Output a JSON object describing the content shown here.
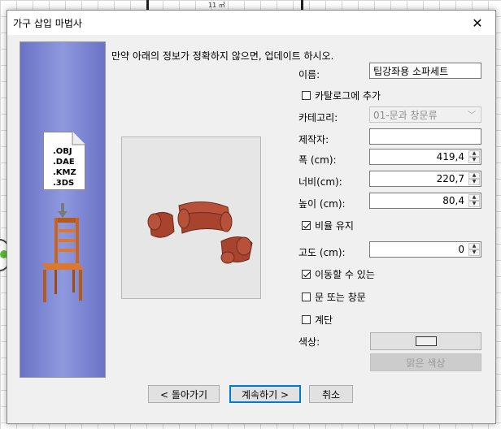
{
  "window": {
    "title": "가구 삽입 마법사",
    "close_glyph": "✕"
  },
  "background": {
    "canvas_text": "11 ㎡"
  },
  "side": {
    "formats": [
      ".OBJ",
      ".DAE",
      ".KMZ",
      ".3DS"
    ]
  },
  "intro": "만약 아래의 정보가 정확하지 않으면, 업데이트 하시오.",
  "form": {
    "name_label": "이름:",
    "name_value": "팁강좌용 소파세트",
    "catalog_label": "카탈로그에 추가",
    "catalog_checked": false,
    "category_label": "카테고리:",
    "category_value": "01-문과 창문류",
    "maker_label": "제작자:",
    "maker_value": "",
    "width_label": "폭 (cm):",
    "width_value": "419,4",
    "depth_label": "너비(cm):",
    "depth_value": "220,7",
    "height_label": "높이 (cm):",
    "height_value": "80,4",
    "ratio_label": "비율 유지",
    "ratio_checked": true,
    "elevation_label": "고도 (cm):",
    "elevation_value": "0",
    "movable_label": "이동할 수 있는",
    "movable_checked": true,
    "door_label": "문 또는 창문",
    "door_checked": false,
    "stairs_label": "계단",
    "stairs_checked": false,
    "color_label": "색상:",
    "clear_color_label": "맑은 색상"
  },
  "buttons": {
    "back": "< 돌아가기",
    "next": "계속하기 >",
    "cancel": "취소"
  },
  "colors": {
    "side_panel": "#7f88d6",
    "sofa": "#a8432e",
    "chair": "#c8641e",
    "default_border": "#0078d7"
  }
}
